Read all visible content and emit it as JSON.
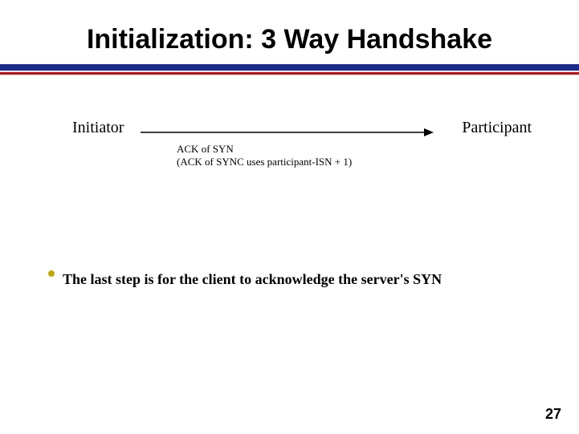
{
  "title": "Initialization: 3 Way Handshake",
  "diagram": {
    "left_label": "Initiator",
    "right_label": "Participant",
    "arrow_caption_line1": "ACK of SYN",
    "arrow_caption_line2": "(ACK of SYNC uses participant-ISN + 1)"
  },
  "bullet": {
    "text": "The last step is for the client to acknowledge the server's SYN"
  },
  "page_number": "27"
}
